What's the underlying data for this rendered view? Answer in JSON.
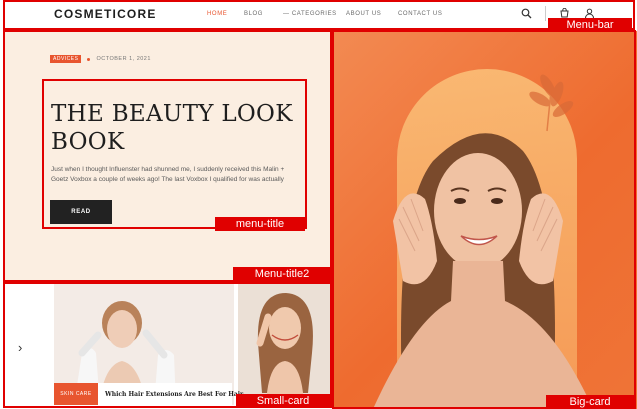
{
  "navbar": {
    "logo": "COSMETICORE",
    "links": [
      "HOME",
      "BLOG",
      "CATEGORIES",
      "ABOUT US",
      "CONTACT US"
    ],
    "active_link": "HOME",
    "icons": [
      "search-icon",
      "cart-icon",
      "user-icon"
    ]
  },
  "hero": {
    "tag": "ADVICES",
    "date": "OCTOBER 1, 2021",
    "title": "THE BEAUTY LOOK BOOK",
    "excerpt": "Just when I thought Influenster had shunned me, I suddenly received this Malin + Goetz Voxbox a couple of weeks ago! The last Voxbox I qualified for was actually",
    "button_label": "READ"
  },
  "cards": {
    "arrow": "›",
    "card1_tag": "SKIN CARE",
    "card1_title": "Which Hair Extensions Are Best For Hair"
  },
  "annotations": {
    "menu_bar": "Menu-bar",
    "menu_title": "menu-title",
    "menu_title2": "Menu-title2",
    "small_card": "Small-card",
    "big_card": "Big-card"
  },
  "colors": {
    "accent": "#e8552f",
    "hero_bg": "#fbeee1",
    "big_card_bg": "#ee6b2f",
    "annotation": "#e00000"
  }
}
